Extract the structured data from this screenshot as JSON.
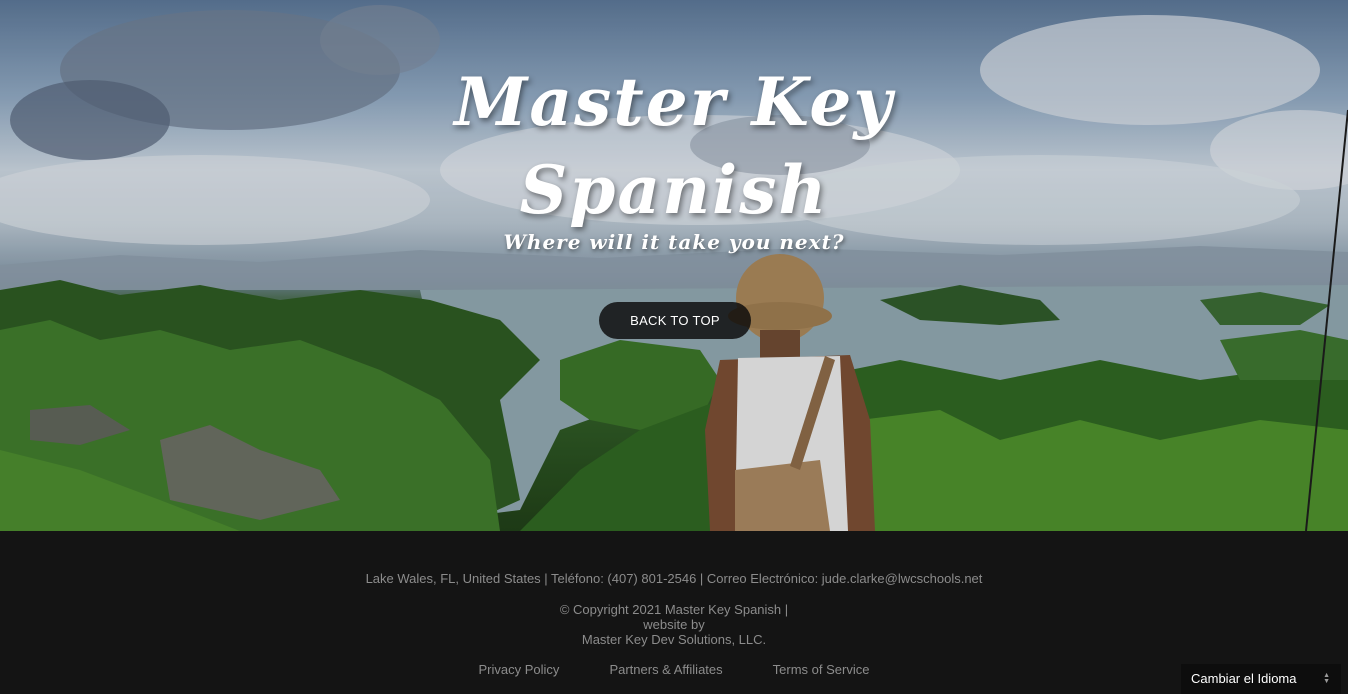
{
  "hero": {
    "title_line1": "Master Key",
    "title_line2": "Spanish",
    "subtitle": "Where will it take you next?",
    "back_to_top": "BACK TO TOP"
  },
  "footer": {
    "contact": "Lake Wales, FL, United States | Teléfono: (407) 801-2546 | Correo Electrónico: jude.clarke@lwcschools.net",
    "copyright_line1": "© Copyright 2021 Master Key Spanish |",
    "copyright_line2": "website by",
    "copyright_line3": "Master Key Dev Solutions, LLC.",
    "links": [
      "Privacy Policy",
      "Partners & Affiliates",
      "Terms of Service"
    ]
  },
  "language_selector": {
    "label": "Cambiar el Idioma"
  },
  "colors": {
    "footer_bg": "#141414",
    "footer_text": "#8c8c8c",
    "button_bg": "#0a0a0a",
    "title_text": "#ffffff"
  }
}
